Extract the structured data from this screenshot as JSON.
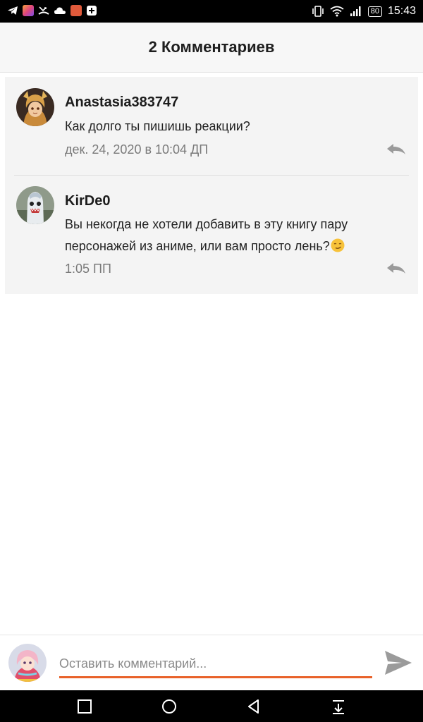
{
  "status_bar": {
    "battery": "80",
    "time": "15:43"
  },
  "header": {
    "title": "2 Комментариев"
  },
  "comments": [
    {
      "author": "Anastasia383747",
      "text": "Как долго ты пишишь реакции?",
      "time": "дек. 24, 2020 в 10:04 ДП"
    },
    {
      "author": "KirDe0",
      "text": "Вы некогда не хотели добавить в эту книгу пару персонажей из аниме, или вам просто лень?",
      "time": "1:05 ПП"
    }
  ],
  "input": {
    "placeholder": "Оставить комментарий..."
  },
  "colors": {
    "accent": "#e8622a",
    "background": "#ffffff",
    "comment_bg": "#f4f4f4"
  }
}
